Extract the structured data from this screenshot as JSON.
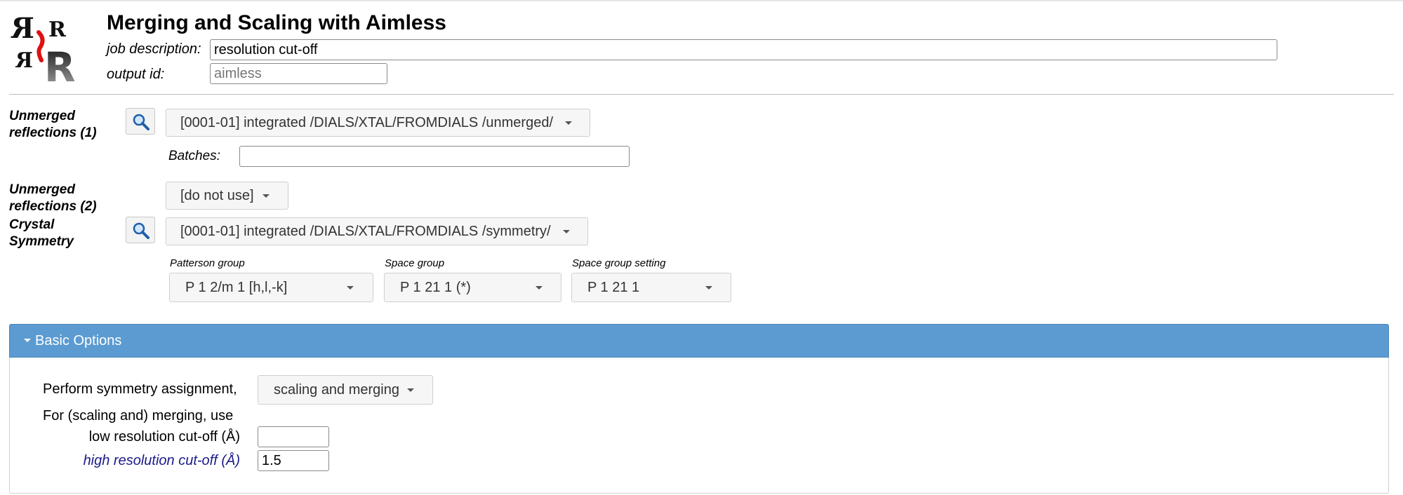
{
  "header": {
    "title": "Merging and Scaling with Aimless",
    "job_description_label": "job description:",
    "job_description_value": "resolution cut-off",
    "output_id_label": "output id:",
    "output_id_placeholder": "aimless"
  },
  "inputs": {
    "unmerged1": {
      "label": "Unmerged reflections (1)",
      "selected": "[0001-01] integrated /DIALS/XTAL/FROMDIALS /unmerged/",
      "batches_label": "Batches:",
      "batches_value": ""
    },
    "unmerged2": {
      "label": "Unmerged reflections (2)",
      "selected": "[do not use]"
    },
    "crystal_symmetry": {
      "label": "Crystal Symmetry",
      "selected": "[0001-01] integrated /DIALS/XTAL/FROMDIALS /symmetry/",
      "patterson_group_label": "Patterson group",
      "patterson_group_value": "P 1 2/m 1 [h,l,-k]",
      "space_group_label": "Space group",
      "space_group_value": "P 1 21 1 (*)",
      "space_group_setting_label": "Space group setting",
      "space_group_setting_value": "P 1 21 1"
    }
  },
  "basic_options": {
    "title": "Basic Options",
    "symmetry_label": "Perform symmetry assignment,",
    "symmetry_value": "scaling and merging",
    "merging_label": "For (scaling and) merging, use",
    "low_res_label": "low resolution cut-off (Å)",
    "low_res_value": "",
    "high_res_label": "high resolution cut-off (Å)",
    "high_res_value": "1.5"
  },
  "colors": {
    "panel_header": "#5b9bd1",
    "highlight_label": "#1a1a8c"
  },
  "icons": [
    "ccp4-logo",
    "search-icon",
    "chevron-down-icon"
  ]
}
